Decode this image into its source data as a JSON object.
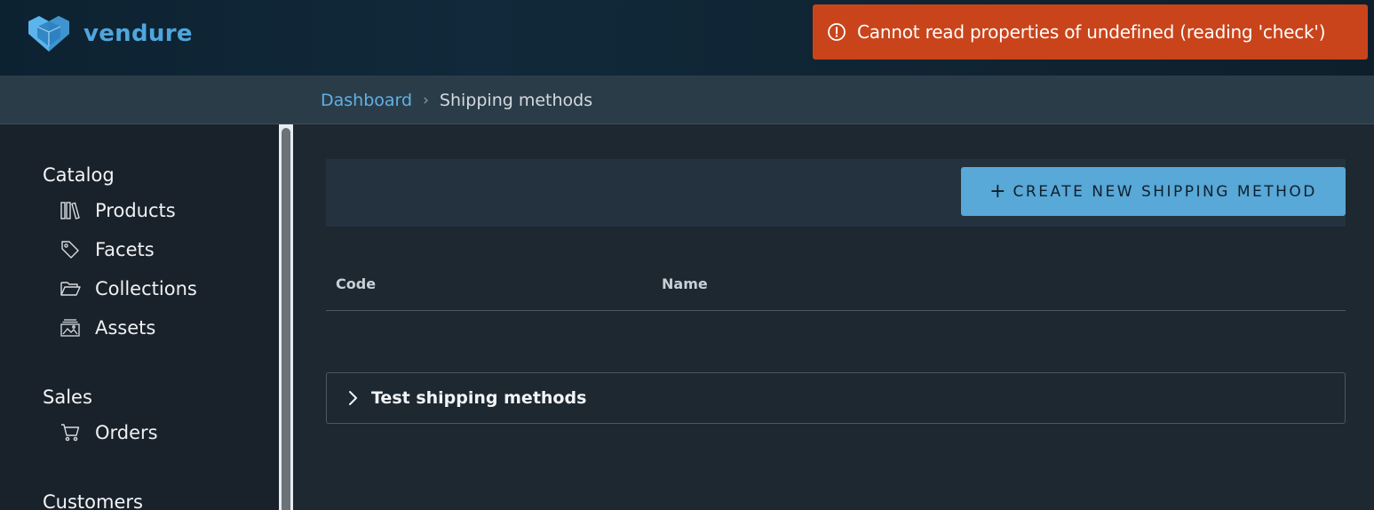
{
  "brand": {
    "name": "vendure",
    "color": "#4fa6dd"
  },
  "toast": {
    "message": "Cannot read properties of undefined (reading 'check')",
    "icon": "exclamation-circle-icon",
    "color": "#c9441b"
  },
  "breadcrumb": {
    "items": [
      {
        "label": "Dashboard"
      },
      {
        "label": "Shipping methods"
      }
    ],
    "separator": "›"
  },
  "sidebar": {
    "sections": [
      {
        "title": "Catalog",
        "items": [
          {
            "label": "Products",
            "icon": "books-icon"
          },
          {
            "label": "Facets",
            "icon": "tag-icon"
          },
          {
            "label": "Collections",
            "icon": "folder-open-icon"
          },
          {
            "label": "Assets",
            "icon": "image-gallery-icon"
          }
        ]
      },
      {
        "title": "Sales",
        "items": [
          {
            "label": "Orders",
            "icon": "shopping-cart-icon"
          }
        ]
      },
      {
        "title": "Customers",
        "items": []
      }
    ]
  },
  "main": {
    "create_button": {
      "icon": "plus-icon",
      "label": "CREATE NEW SHIPPING METHOD"
    },
    "table": {
      "columns": [
        "Code",
        "Name"
      ],
      "rows": []
    },
    "test_panel": {
      "label": "Test shipping methods",
      "icon": "chevron-right-icon"
    }
  }
}
